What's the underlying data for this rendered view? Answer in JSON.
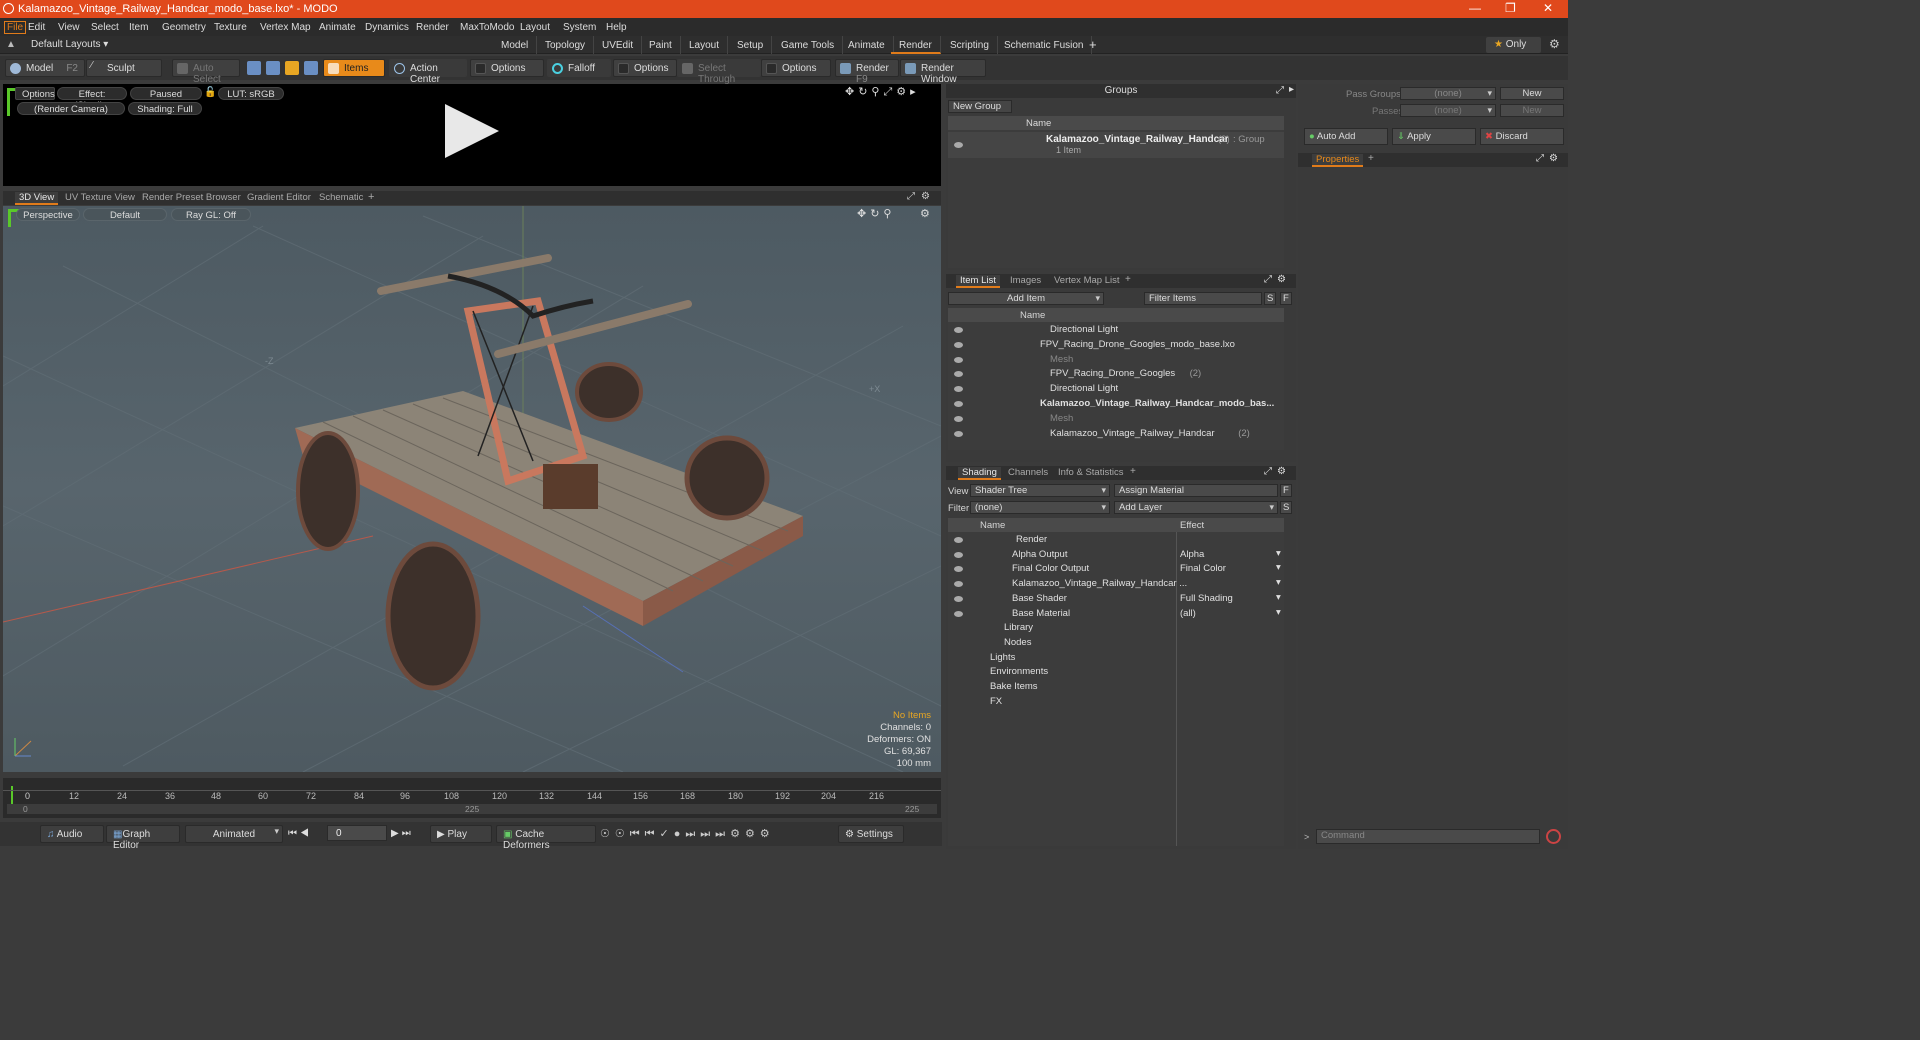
{
  "window": {
    "title": "Kalamazoo_Vintage_Railway_Handcar_modo_base.lxo* - MODO"
  },
  "menu": [
    "File",
    "Edit",
    "View",
    "Select",
    "Item",
    "Geometry",
    "Texture",
    "Vertex Map",
    "Animate",
    "Dynamics",
    "Render",
    "MaxToModo",
    "Layout",
    "System",
    "Help"
  ],
  "layouts": {
    "label": "Default Layouts",
    "tabs": [
      "Model",
      "Topology",
      "UVEdit",
      "Paint",
      "Layout",
      "Setup",
      "Game Tools",
      "Animate",
      "Render",
      "Scripting",
      "Schematic Fusion"
    ],
    "active": "Render",
    "only": "Only"
  },
  "toolbar": {
    "model": "Model",
    "model_key": "F2",
    "sculpt": "Sculpt",
    "auto_select": "Auto Select",
    "items": "Items",
    "action_center": "Action Center",
    "options1": "Options",
    "falloff": "Falloff",
    "options2": "Options",
    "select_through": "Select Through",
    "options3": "Options",
    "render": "Render",
    "render_key": "F9",
    "render_window": "Render Window"
  },
  "preview": {
    "options": "Options",
    "effect": "Effect: (Shadi...",
    "paused": "Paused",
    "lut": "LUT: sRGB",
    "camera": "(Render Camera)",
    "shading": "Shading: Full"
  },
  "viewport_tabs": [
    "3D View",
    "UV Texture View",
    "Render Preset Browser",
    "Gradient Editor",
    "Schematic"
  ],
  "viewport": {
    "perspective": "Perspective",
    "default": "Default",
    "raygl": "Ray GL: Off",
    "axis_neg_z": "-Z",
    "axis_pos_x": "+X",
    "status": {
      "no_items": "No Items",
      "channels": "Channels: 0",
      "deformers": "Deformers: ON",
      "gl": "GL: 69,367",
      "scale": "100 mm"
    }
  },
  "timeline": {
    "ticks": [
      "0",
      "12",
      "24",
      "36",
      "48",
      "60",
      "72",
      "84",
      "96",
      "108",
      "120",
      "132",
      "144",
      "156",
      "168",
      "180",
      "192",
      "204",
      "216"
    ],
    "start": "0",
    "mid": "225",
    "end": "225"
  },
  "bottom": {
    "audio": "Audio",
    "graph_editor": "Graph Editor",
    "animated": "Animated",
    "frame": "0",
    "play": "Play",
    "cache": "Cache Deformers",
    "settings": "Settings"
  },
  "groups": {
    "title": "Groups",
    "new_group": "New Group",
    "col_name": "Name",
    "item_name": "Kalamazoo_Vintage_Railway_Handcar",
    "item_count": "(3)",
    "item_type": ": Group",
    "item_sub": "1 Item"
  },
  "itemlist": {
    "tabs": [
      "Item List",
      "Images",
      "Vertex Map List"
    ],
    "add_item": "Add Item",
    "filter": "Filter Items",
    "col_name": "Name",
    "rows": [
      {
        "label": "Directional Light",
        "indent": 2,
        "dim": false,
        "bold": false,
        "count": ""
      },
      {
        "label": "FPV_Racing_Drone_Googles_modo_base.lxo",
        "indent": 1,
        "dim": false,
        "bold": false,
        "count": ""
      },
      {
        "label": "Mesh",
        "indent": 2,
        "dim": true,
        "bold": false,
        "count": ""
      },
      {
        "label": "FPV_Racing_Drone_Googles",
        "indent": 2,
        "dim": false,
        "bold": false,
        "count": "(2)"
      },
      {
        "label": "Directional Light",
        "indent": 2,
        "dim": false,
        "bold": false,
        "count": ""
      },
      {
        "label": "Kalamazoo_Vintage_Railway_Handcar_modo_bas...",
        "indent": 1,
        "dim": false,
        "bold": true,
        "count": ""
      },
      {
        "label": "Mesh",
        "indent": 2,
        "dim": true,
        "bold": false,
        "count": ""
      },
      {
        "label": "Kalamazoo_Vintage_Railway_Handcar",
        "indent": 2,
        "dim": false,
        "bold": false,
        "count": "(2)"
      }
    ]
  },
  "shading": {
    "tabs": [
      "Shading",
      "Channels",
      "Info & Statistics"
    ],
    "view_label": "View",
    "view_value": "Shader Tree",
    "assign": "Assign Material",
    "filter_label": "Filter",
    "filter_value": "(none)",
    "add_layer": "Add Layer",
    "col_name": "Name",
    "col_effect": "Effect",
    "rows": [
      {
        "name": "Render",
        "effect": "",
        "indent": 1
      },
      {
        "name": "Alpha Output",
        "effect": "Alpha",
        "indent": 2
      },
      {
        "name": "Final Color Output",
        "effect": "Final Color",
        "indent": 2
      },
      {
        "name": "Kalamazoo_Vintage_Railway_Handcar ...",
        "effect": "",
        "indent": 2
      },
      {
        "name": "Base Shader",
        "effect": "Full Shading",
        "indent": 2
      },
      {
        "name": "Base Material",
        "effect": "(all)",
        "indent": 2
      },
      {
        "name": "Library",
        "effect": "",
        "indent": 1
      },
      {
        "name": "Nodes",
        "effect": "",
        "indent": 1
      },
      {
        "name": "Lights",
        "effect": "",
        "indent": 0
      },
      {
        "name": "Environments",
        "effect": "",
        "indent": 0
      },
      {
        "name": "Bake Items",
        "effect": "",
        "indent": 0
      },
      {
        "name": "FX",
        "effect": "",
        "indent": 0
      }
    ]
  },
  "right": {
    "pass_groups": "Pass Groups",
    "passes": "Passes",
    "none1": "(none)",
    "none2": "(none)",
    "new1": "New",
    "new2": "New",
    "auto_add": "Auto Add",
    "apply": "Apply",
    "discard": "Discard",
    "properties": "Properties",
    "command": "Command"
  },
  "colors": {
    "title_bar": "#e0491c",
    "accent": "#e8891a"
  }
}
